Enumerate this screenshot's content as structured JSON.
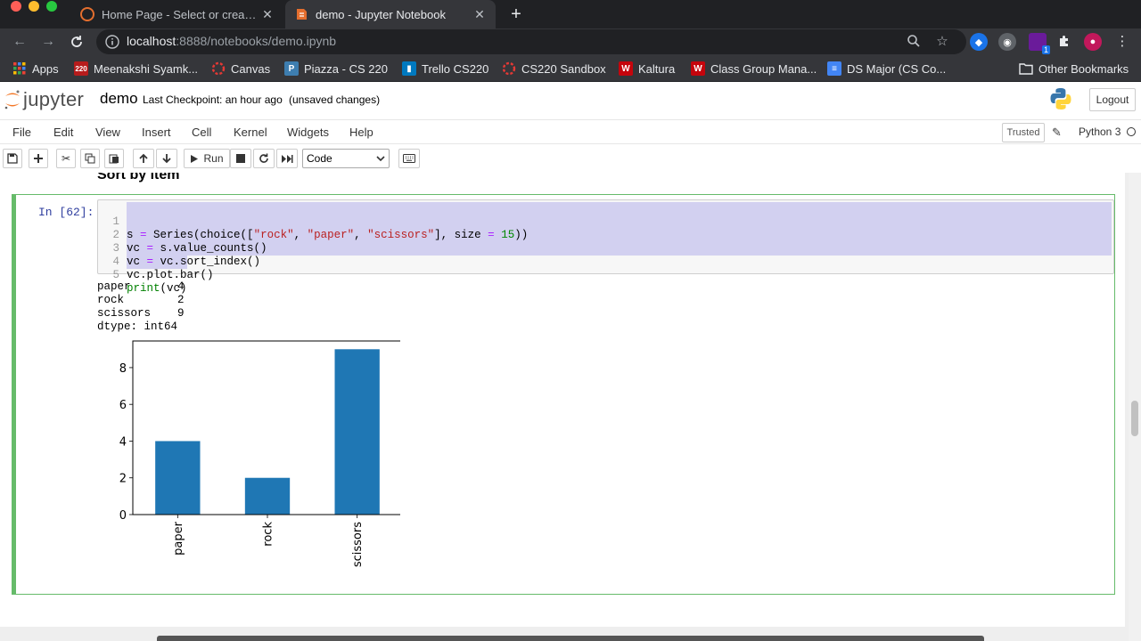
{
  "browser": {
    "tabs": [
      {
        "title": "Home Page - Select or create a",
        "active": false
      },
      {
        "title": "demo - Jupyter Notebook",
        "active": true
      }
    ],
    "url_host": "localhost",
    "url_path": ":8888/notebooks/demo.ipynb",
    "bookmarks": [
      "Apps",
      "Meenakshi Syamk...",
      "Canvas",
      "Piazza - CS 220",
      "Trello CS220",
      "CS220 Sandbox",
      "Kaltura",
      "Class Group Mana...",
      "DS Major (CS Co..."
    ],
    "other_bookmarks": "Other Bookmarks",
    "ext_badge": "1"
  },
  "jupyter": {
    "logo_text": "jupyter",
    "notebook_name": "demo",
    "checkpoint": "Last Checkpoint: an hour ago",
    "unsaved": "(unsaved changes)",
    "logout_label": "Logout",
    "menu": [
      "File",
      "Edit",
      "View",
      "Insert",
      "Cell",
      "Kernel",
      "Widgets",
      "Help"
    ],
    "trusted_label": "Trusted",
    "kernel_name": "Python 3",
    "run_label": "Run",
    "cell_type": "Code"
  },
  "notebook": {
    "heading": "Sort by item",
    "prompt": "In [62]:",
    "line_numbers": [
      "1",
      "2",
      "3",
      "4",
      "5"
    ],
    "output_lines": [
      "paper       4",
      "rock        2",
      "scissors    9",
      "dtype: int64"
    ]
  },
  "chart_data": {
    "type": "bar",
    "categories": [
      "paper",
      "rock",
      "scissors"
    ],
    "values": [
      4,
      2,
      9
    ],
    "ylim": [
      0,
      9.45
    ],
    "yticks": [
      0,
      2,
      4,
      6,
      8
    ],
    "bar_color": "#1f77b4",
    "grid": false
  },
  "colors": {
    "chrome_dark": "#202124",
    "chrome_mid": "#35363a",
    "cell_border": "#66bb6a",
    "prompt": "#303f9f",
    "selection": "#d2d0f0"
  }
}
